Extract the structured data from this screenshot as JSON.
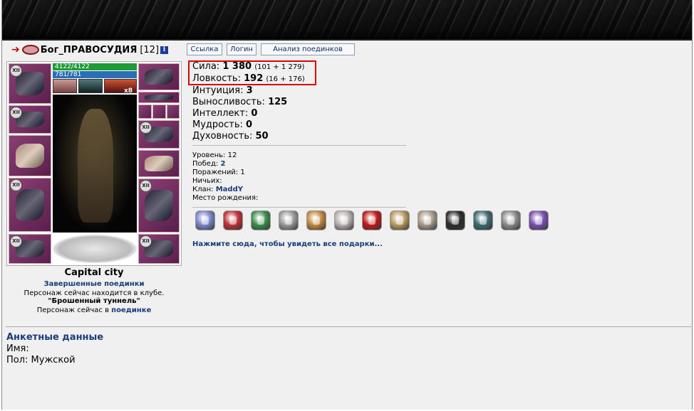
{
  "header": {
    "nick": "Бог_ПРАВОСУДИЯ",
    "level": "[12]",
    "info_icon": "i"
  },
  "buttons": {
    "link": "Ссылка",
    "login": "Логин",
    "analysis": "Анализ поединков"
  },
  "doll": {
    "hp": "4122/4122",
    "mp": "781/781",
    "effect_count": "x8",
    "slot_badge": "XII"
  },
  "location": {
    "city": "Capital city",
    "finished_battles": "Завершенные поединки",
    "in_club": "Персонаж сейчас находится в клубе.",
    "club_name": "\"Брошенный туннель\"",
    "in_battle_prefix": "Персонаж сейчас в",
    "in_battle_link": "поединке"
  },
  "stats": [
    {
      "label": "Сила:",
      "value": "1 380",
      "detail": "(101 + 1 279)"
    },
    {
      "label": "Ловкость:",
      "value": "192",
      "detail": "(16 + 176)"
    },
    {
      "label": "Интуиция:",
      "value": "3",
      "detail": ""
    },
    {
      "label": "Выносливость:",
      "value": "125",
      "detail": ""
    },
    {
      "label": "Интеллект:",
      "value": "0",
      "detail": ""
    },
    {
      "label": "Мудрость:",
      "value": "0",
      "detail": ""
    },
    {
      "label": "Духовность:",
      "value": "50",
      "detail": ""
    }
  ],
  "info": {
    "level_label": "Уровень:",
    "level_value": "12",
    "wins_label": "Побед:",
    "wins_value": "2",
    "losses_label": "Поражений:",
    "losses_value": "1",
    "draws_label": "Ничьих:",
    "draws_value": "",
    "clan_label": "Клан:",
    "clan_value": "MaddY",
    "birth_label": "Место рождения:",
    "birth_value": ""
  },
  "gifts": {
    "colors": [
      "#7b86c9",
      "#c0303a",
      "#3b8e4a",
      "#9a9a9a",
      "#c28a40",
      "#b9b0b0",
      "#c01818",
      "#b89a60",
      "#a89a8a",
      "#2a2a2a",
      "#3c6a70",
      "#8a8a8a",
      "#7a50b0"
    ],
    "all_link": "Нажмите сюда, чтобы увидеть все подарки..."
  },
  "profile": {
    "title": "Анкетные данные",
    "name_label": "Имя:",
    "gender": "Пол: Мужской"
  }
}
